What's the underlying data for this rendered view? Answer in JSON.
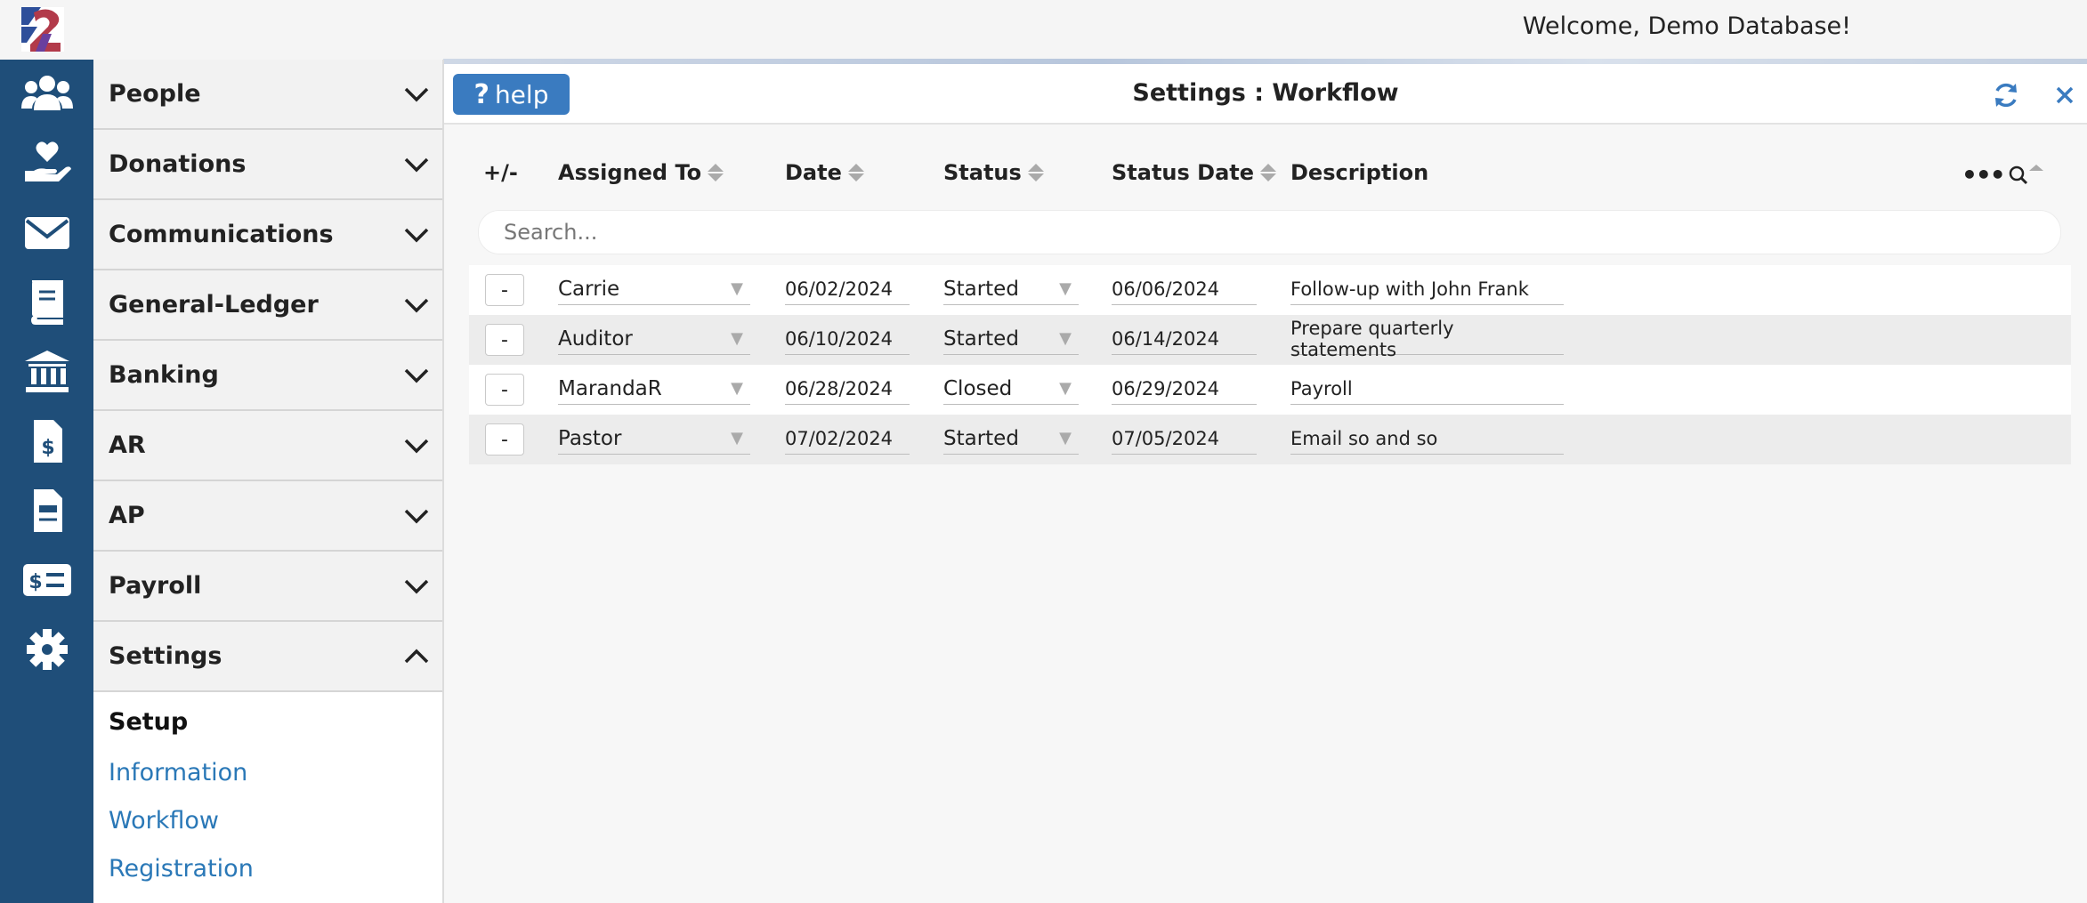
{
  "topbar": {
    "welcome": "Welcome, Demo Database!"
  },
  "rail": {
    "icons": [
      "people-icon",
      "donations-icon",
      "communications-icon",
      "ledger-icon",
      "banking-icon",
      "ar-icon",
      "ap-icon",
      "payroll-icon",
      "settings-icon"
    ]
  },
  "nav": {
    "items": [
      {
        "label": "People"
      },
      {
        "label": "Donations"
      },
      {
        "label": "Communications"
      },
      {
        "label": "General-Ledger"
      },
      {
        "label": "Banking"
      },
      {
        "label": "AR"
      },
      {
        "label": "AP"
      },
      {
        "label": "Payroll"
      },
      {
        "label": "Settings"
      }
    ],
    "settings_sub": {
      "title": "Setup",
      "links": [
        "Information",
        "Workflow",
        "Registration"
      ]
    }
  },
  "main": {
    "help_label": "help",
    "help_glyph": "?",
    "title": "Settings : Workflow",
    "columns": {
      "plusminus": "+/-",
      "assigned": "Assigned To",
      "date": "Date",
      "status": "Status",
      "status_date": "Status Date",
      "description": "Description"
    },
    "more_label": "•••",
    "search_placeholder": "Search...",
    "rows": [
      {
        "minus": "-",
        "assigned": "Carrie",
        "date": "06/02/2024",
        "status": "Started",
        "status_date": "06/06/2024",
        "description": "Follow-up with John Frank"
      },
      {
        "minus": "-",
        "assigned": "Auditor",
        "date": "06/10/2024",
        "status": "Started",
        "status_date": "06/14/2024",
        "description": "Prepare quarterly statements"
      },
      {
        "minus": "-",
        "assigned": "MarandaR",
        "date": "06/28/2024",
        "status": "Closed",
        "status_date": "06/29/2024",
        "description": "Payroll"
      },
      {
        "minus": "-",
        "assigned": "Pastor",
        "date": "07/02/2024",
        "status": "Started",
        "status_date": "07/05/2024",
        "description": "Email so and so"
      }
    ]
  },
  "colors": {
    "rail_bg": "#1f4e79",
    "accent_blue": "#3a7bc0",
    "link_blue": "#2a78b7"
  }
}
